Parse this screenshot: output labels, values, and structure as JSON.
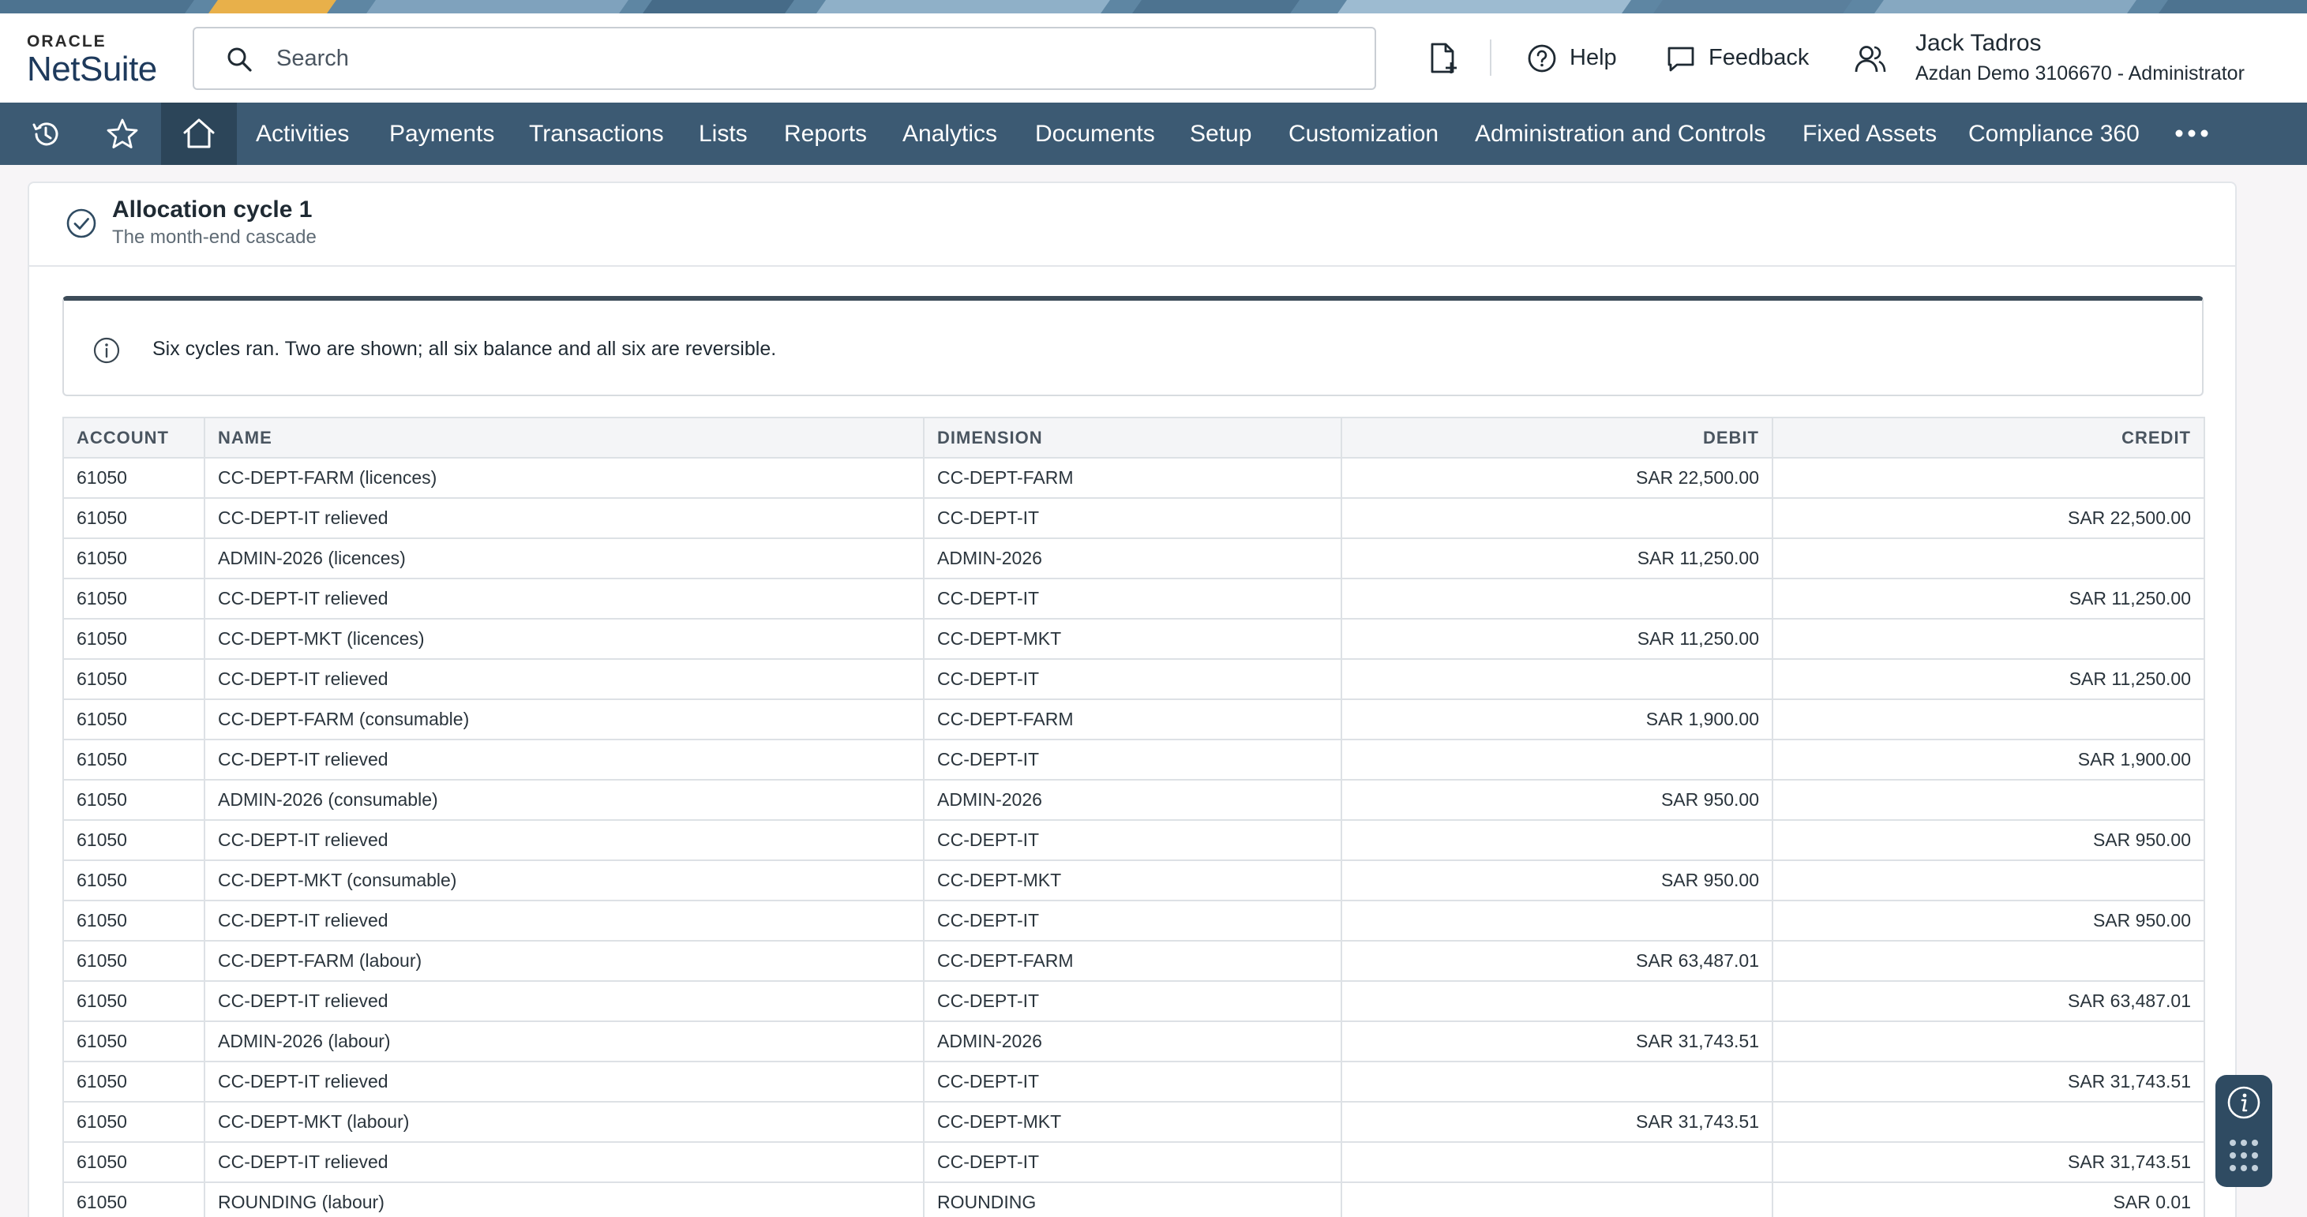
{
  "brand": {
    "oracle": "ORACLE",
    "netsuite": "NetSuite"
  },
  "colors": {
    "nav_bg": "#3c5a73",
    "nav_active": "#2c4559",
    "accent": "#1e3a5c",
    "strip": "#5e86a3"
  },
  "search": {
    "placeholder": "Search"
  },
  "header": {
    "new_doc_icon": "document-plus-icon",
    "help_label": "Help",
    "feedback_label": "Feedback",
    "user_name": "Jack Tadros",
    "user_sub": "Azdan Demo 3106670 - Administrator"
  },
  "nav": {
    "icons": [
      "history-icon",
      "star-icon",
      "home-icon"
    ],
    "items": [
      "Activities",
      "Payments",
      "Transactions",
      "Lists",
      "Reports",
      "Analytics",
      "Documents",
      "Setup",
      "Customization",
      "Administration and Controls",
      "Fixed Assets",
      "Compliance 360"
    ],
    "more_icon": "ellipsis-icon"
  },
  "cycle": {
    "title": "Allocation cycle 1",
    "subtitle": "The month-end cascade"
  },
  "info": {
    "text": "Six cycles ran. Two are shown; all six balance and all six are reversible."
  },
  "table": {
    "headers": {
      "account": "ACCOUNT",
      "name": "NAME",
      "dimension": "DIMENSION",
      "debit": "DEBIT",
      "credit": "CREDIT"
    },
    "rows": [
      [
        "61050",
        "CC-DEPT-FARM (licences)",
        "CC-DEPT-FARM",
        "SAR 22,500.00",
        ""
      ],
      [
        "61050",
        "CC-DEPT-IT relieved",
        "CC-DEPT-IT",
        "",
        "SAR 22,500.00"
      ],
      [
        "61050",
        "ADMIN-2026 (licences)",
        "ADMIN-2026",
        "SAR 11,250.00",
        ""
      ],
      [
        "61050",
        "CC-DEPT-IT relieved",
        "CC-DEPT-IT",
        "",
        "SAR 11,250.00"
      ],
      [
        "61050",
        "CC-DEPT-MKT (licences)",
        "CC-DEPT-MKT",
        "SAR 11,250.00",
        ""
      ],
      [
        "61050",
        "CC-DEPT-IT relieved",
        "CC-DEPT-IT",
        "",
        "SAR 11,250.00"
      ],
      [
        "61050",
        "CC-DEPT-FARM (consumable)",
        "CC-DEPT-FARM",
        "SAR 1,900.00",
        ""
      ],
      [
        "61050",
        "CC-DEPT-IT relieved",
        "CC-DEPT-IT",
        "",
        "SAR 1,900.00"
      ],
      [
        "61050",
        "ADMIN-2026 (consumable)",
        "ADMIN-2026",
        "SAR 950.00",
        ""
      ],
      [
        "61050",
        "CC-DEPT-IT relieved",
        "CC-DEPT-IT",
        "",
        "SAR 950.00"
      ],
      [
        "61050",
        "CC-DEPT-MKT (consumable)",
        "CC-DEPT-MKT",
        "SAR 950.00",
        ""
      ],
      [
        "61050",
        "CC-DEPT-IT relieved",
        "CC-DEPT-IT",
        "",
        "SAR 950.00"
      ],
      [
        "61050",
        "CC-DEPT-FARM (labour)",
        "CC-DEPT-FARM",
        "SAR 63,487.01",
        ""
      ],
      [
        "61050",
        "CC-DEPT-IT relieved",
        "CC-DEPT-IT",
        "",
        "SAR 63,487.01"
      ],
      [
        "61050",
        "ADMIN-2026 (labour)",
        "ADMIN-2026",
        "SAR 31,743.51",
        ""
      ],
      [
        "61050",
        "CC-DEPT-IT relieved",
        "CC-DEPT-IT",
        "",
        "SAR 31,743.51"
      ],
      [
        "61050",
        "CC-DEPT-MKT (labour)",
        "CC-DEPT-MKT",
        "SAR 31,743.51",
        ""
      ],
      [
        "61050",
        "CC-DEPT-IT relieved",
        "CC-DEPT-IT",
        "",
        "SAR 31,743.51"
      ],
      [
        "61050",
        "ROUNDING (labour)",
        "ROUNDING",
        "",
        "SAR 0.01"
      ]
    ]
  },
  "fab": {
    "icon": "info-icon",
    "apps_icon": "grid-dots-icon"
  }
}
